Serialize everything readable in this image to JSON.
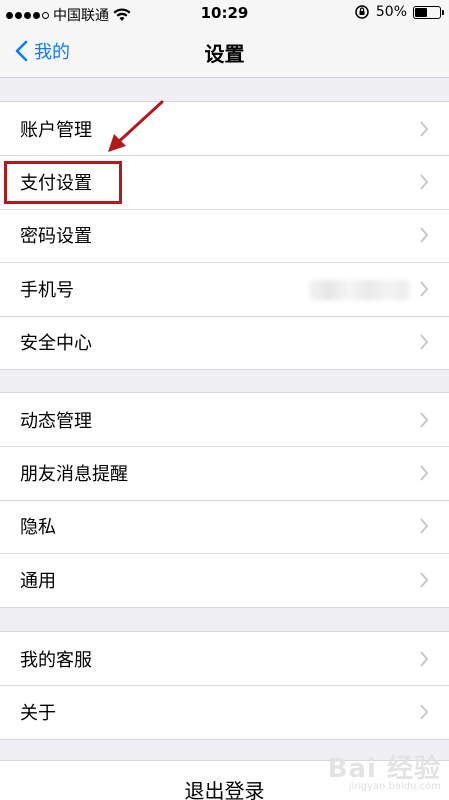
{
  "status_bar": {
    "carrier": "中国联通",
    "time": "10:29",
    "battery_text": "50%",
    "battery_level": 0.5
  },
  "nav": {
    "back_label": "我的",
    "title": "设置"
  },
  "groups": [
    {
      "items": [
        {
          "label": "账户管理"
        },
        {
          "label": "支付设置"
        },
        {
          "label": "密码设置"
        },
        {
          "label": "手机号"
        },
        {
          "label": "安全中心"
        }
      ]
    },
    {
      "items": [
        {
          "label": "动态管理"
        },
        {
          "label": "朋友消息提醒"
        },
        {
          "label": "隐私"
        },
        {
          "label": "通用"
        }
      ]
    },
    {
      "items": [
        {
          "label": "我的客服"
        },
        {
          "label": "关于"
        }
      ]
    }
  ],
  "logout_label": "退出登录",
  "watermark": {
    "main": "Bai 经验",
    "sub": "jingyan.baidu.com"
  },
  "accent_color": "#0a7cff",
  "highlight_color": "#b21a1a"
}
